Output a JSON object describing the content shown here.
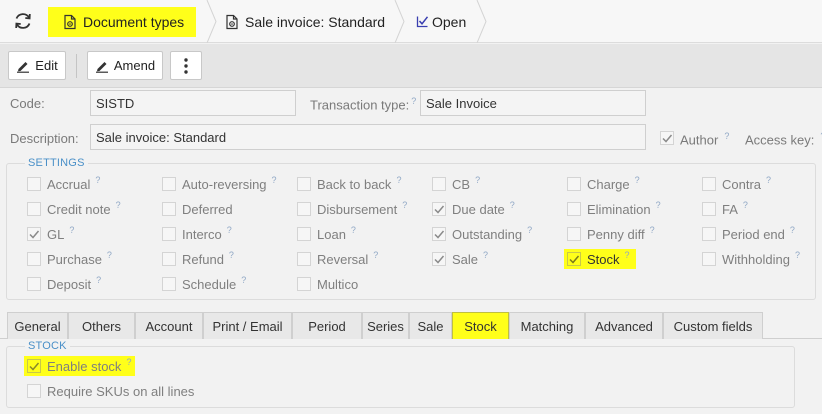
{
  "breadcrumb": {
    "items": [
      {
        "label": "Document types",
        "icon": "gear-document-icon",
        "highlighted": true
      },
      {
        "label": "Sale invoice: Standard",
        "icon": "gear-document-icon",
        "highlighted": false
      },
      {
        "label": "Open",
        "icon": "edit-checkmark-icon",
        "highlighted": false
      }
    ]
  },
  "toolbar": {
    "edit_label": "Edit",
    "amend_label": "Amend"
  },
  "form": {
    "code_label": "Code:",
    "code_value": "SISTD",
    "transaction_type_label": "Transaction type:",
    "transaction_type_value": "Sale Invoice",
    "description_label": "Description:",
    "description_value": "Sale invoice: Standard",
    "author_label": "Author",
    "author_checked": true,
    "access_key_label": "Access key:",
    "help_mark": "?"
  },
  "settings": {
    "legend": "SETTINGS",
    "options": [
      {
        "label": "Accrual",
        "checked": false
      },
      {
        "label": "Auto-reversing",
        "checked": false
      },
      {
        "label": "Back to back",
        "checked": false
      },
      {
        "label": "CB",
        "checked": false
      },
      {
        "label": "Charge",
        "checked": false
      },
      {
        "label": "Contra",
        "checked": false
      },
      {
        "label": "Credit note",
        "checked": false
      },
      {
        "label": "Deferred",
        "checked": false
      },
      {
        "label": "Disbursement",
        "checked": false
      },
      {
        "label": "Due date",
        "checked": true
      },
      {
        "label": "Elimination",
        "checked": false
      },
      {
        "label": "FA",
        "checked": false
      },
      {
        "label": "GL",
        "checked": true
      },
      {
        "label": "Interco",
        "checked": false
      },
      {
        "label": "Loan",
        "checked": false
      },
      {
        "label": "Outstanding",
        "checked": true
      },
      {
        "label": "Penny diff",
        "checked": false
      },
      {
        "label": "Period end",
        "checked": false
      },
      {
        "label": "Purchase",
        "checked": false
      },
      {
        "label": "Refund",
        "checked": false
      },
      {
        "label": "Reversal",
        "checked": false
      },
      {
        "label": "Sale",
        "checked": true
      },
      {
        "label": "Stock",
        "checked": true,
        "highlighted": true
      },
      {
        "label": "Withholding",
        "checked": false
      },
      {
        "label": "Deposit",
        "checked": false
      },
      {
        "label": "Schedule",
        "checked": false
      },
      {
        "label": "Multico",
        "checked": false
      }
    ]
  },
  "tabs": [
    {
      "label": "General",
      "active": false
    },
    {
      "label": "Others",
      "active": false
    },
    {
      "label": "Account",
      "active": false
    },
    {
      "label": "Print / Email",
      "active": false
    },
    {
      "label": "Period",
      "active": false
    },
    {
      "label": "Series",
      "active": false
    },
    {
      "label": "Sale",
      "active": false
    },
    {
      "label": "Stock",
      "active": true
    },
    {
      "label": "Matching",
      "active": false
    },
    {
      "label": "Advanced",
      "active": false
    },
    {
      "label": "Custom fields",
      "active": false
    }
  ],
  "stock": {
    "legend": "STOCK",
    "enable_stock_label": "Enable stock",
    "enable_stock_checked": true,
    "require_skus_label": "Require SKUs on all lines",
    "require_skus_checked": false
  },
  "colors": {
    "highlight": "#ffff1a",
    "legend": "#4a90c8",
    "help_mark": "#8fa7c5"
  }
}
